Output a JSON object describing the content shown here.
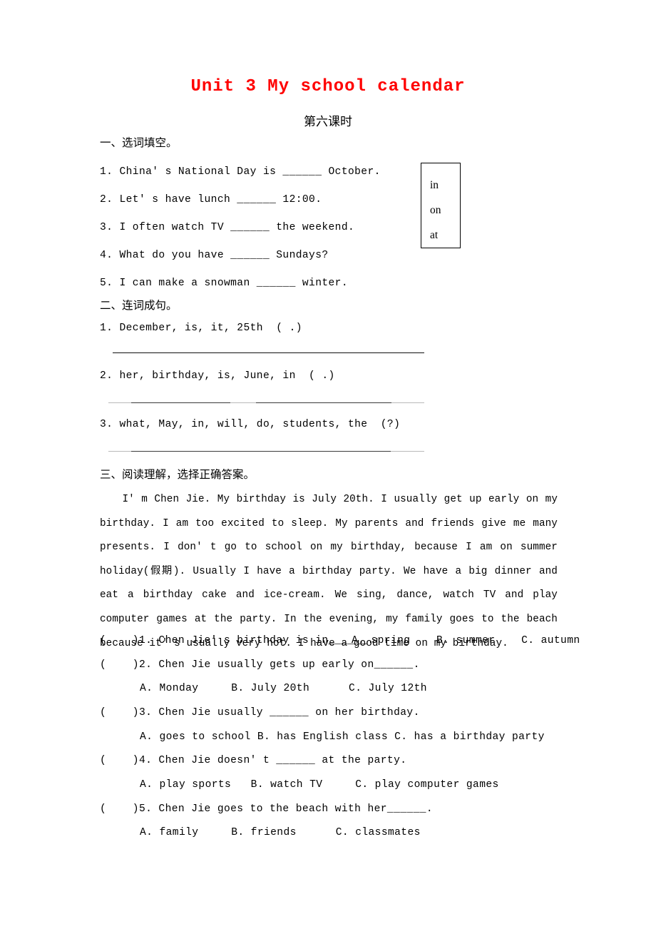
{
  "document": {
    "title": "Unit 3 My school calendar",
    "subtitle": "第六课时",
    "title_color": "#ff0000"
  },
  "section1": {
    "heading": "一、选词填空。",
    "questions": [
      "1. China' s National Day is ______ October.",
      "2. Let' s have lunch ______ 12:00.",
      "3. I often watch TV ______ the weekend.",
      "4. What do you have ______ Sundays?",
      "5. I can make a snowman ______ winter."
    ],
    "word_box": [
      "in",
      "on",
      "at"
    ]
  },
  "section2": {
    "heading": "二、连词成句。",
    "questions": [
      "1. December, is, it, 25th  ( .)",
      "2. her, birthday, is, June, in  ( .)",
      "3. what, May, in, will, do, students, the  (?)"
    ]
  },
  "section3": {
    "heading": "三、阅读理解，选择正确答案。",
    "passage": "I' m Chen Jie. My birthday is July 20th. I usually get up early on my birthday. I am too excited to sleep. My parents and friends give me many presents. I don' t go to school on my birthday, because I am on summer holiday(假期). Usually I have a birthday party. We have a big dinner and eat a birthday cake and ice-cream. We sing, dance, watch TV and play computer games at the party. In the evening, my family goes to the beach because it' s usually very hot. I have a good time on my birthday.",
    "questions": [
      {
        "stem": "(    )1. Chen Jie' s birthday is in______.",
        "options_inline": "A. spring    B. summer    C. autumn",
        "options_below": ""
      },
      {
        "stem": "(    )2. Chen Jie usually gets up early on______.",
        "options_inline": "",
        "options_below": "A. Monday     B. July 20th      C. July 12th"
      },
      {
        "stem": "(    )3. Chen Jie usually ______ on her birthday.",
        "options_inline": "",
        "options_below": "A. goes to school B. has English class C. has a birthday party"
      },
      {
        "stem": "(    )4. Chen Jie doesn' t ______ at the party.",
        "options_inline": "",
        "options_below": "A. play sports   B. watch TV     C. play computer games"
      },
      {
        "stem": "(    )5. Chen Jie goes to the beach with her______.",
        "options_inline": "",
        "options_below": "A. family     B. friends      C. classmates"
      }
    ]
  }
}
